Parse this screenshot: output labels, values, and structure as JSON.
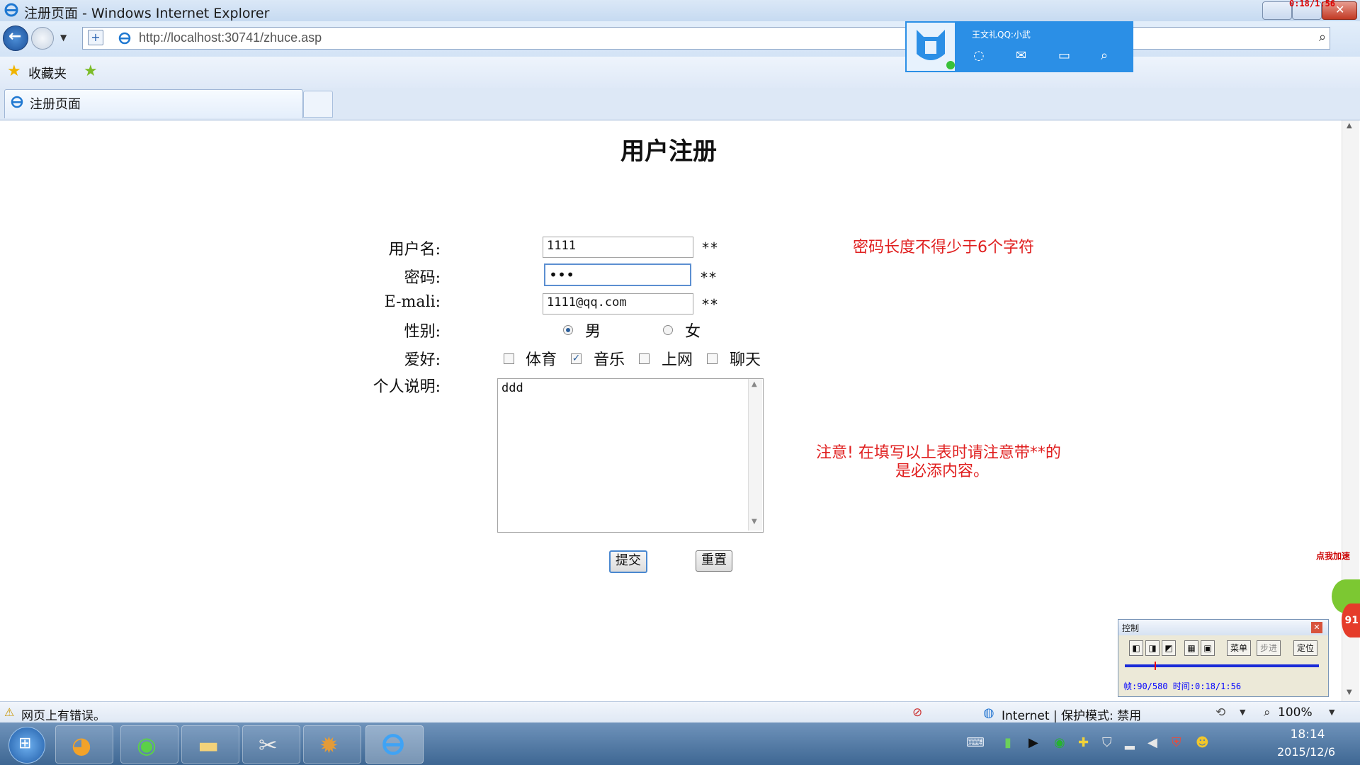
{
  "window": {
    "title": "注册页面 - Windows Internet Explorer",
    "recorder_time": "0:18/1:56"
  },
  "address_bar": {
    "url": "http://localhost:30741/zhuce.asp"
  },
  "favorites": {
    "label": "收藏夹"
  },
  "tabs": [
    {
      "label": "注册页面",
      "active": true
    }
  ],
  "qq_popup": {
    "name": "王文礼QQ:小武"
  },
  "form": {
    "title": "用户注册",
    "username_label": "用户名:",
    "username_value": "1111",
    "password_label": "密码:",
    "password_value": "•••",
    "email_label": "E-mali:",
    "email_value": "1111@qq.com",
    "required_mark": "**",
    "gender_label": "性别:",
    "gender_options": [
      "男",
      "女"
    ],
    "gender_selected": "男",
    "hobby_label": "爱好:",
    "hobby_options": [
      {
        "label": "体育",
        "checked": false
      },
      {
        "label": "音乐",
        "checked": true
      },
      {
        "label": "上网",
        "checked": false
      },
      {
        "label": "聊天",
        "checked": false
      }
    ],
    "note_label": "个人说明:",
    "note_value": "ddd",
    "submit_label": "提交",
    "reset_label": "重置"
  },
  "messages": {
    "password_hint": "密码长度不得少于6个字符",
    "notice_line1": "注意! 在填写以上表时请注意带**的",
    "notice_line2": "是必添内容。"
  },
  "status_bar": {
    "message": "网页上有错误。",
    "zone": "Internet | 保护模式: 禁用",
    "zoom": "100%"
  },
  "taskbar": {
    "time": "18:14",
    "date": "2015/12/6"
  },
  "control_widget": {
    "title": "控制",
    "menu_label": "菜单",
    "step_label": "步进",
    "locate_label": "定位",
    "frames": "帧:90/580 时间:0:18/1:56",
    "progress": 0.155
  },
  "side_widget": {
    "label": "点我加速",
    "value": "91"
  },
  "colors": {
    "error_red": "#e02020",
    "qq_blue": "#2b8fe6",
    "taskbar": "#4a72a0"
  }
}
